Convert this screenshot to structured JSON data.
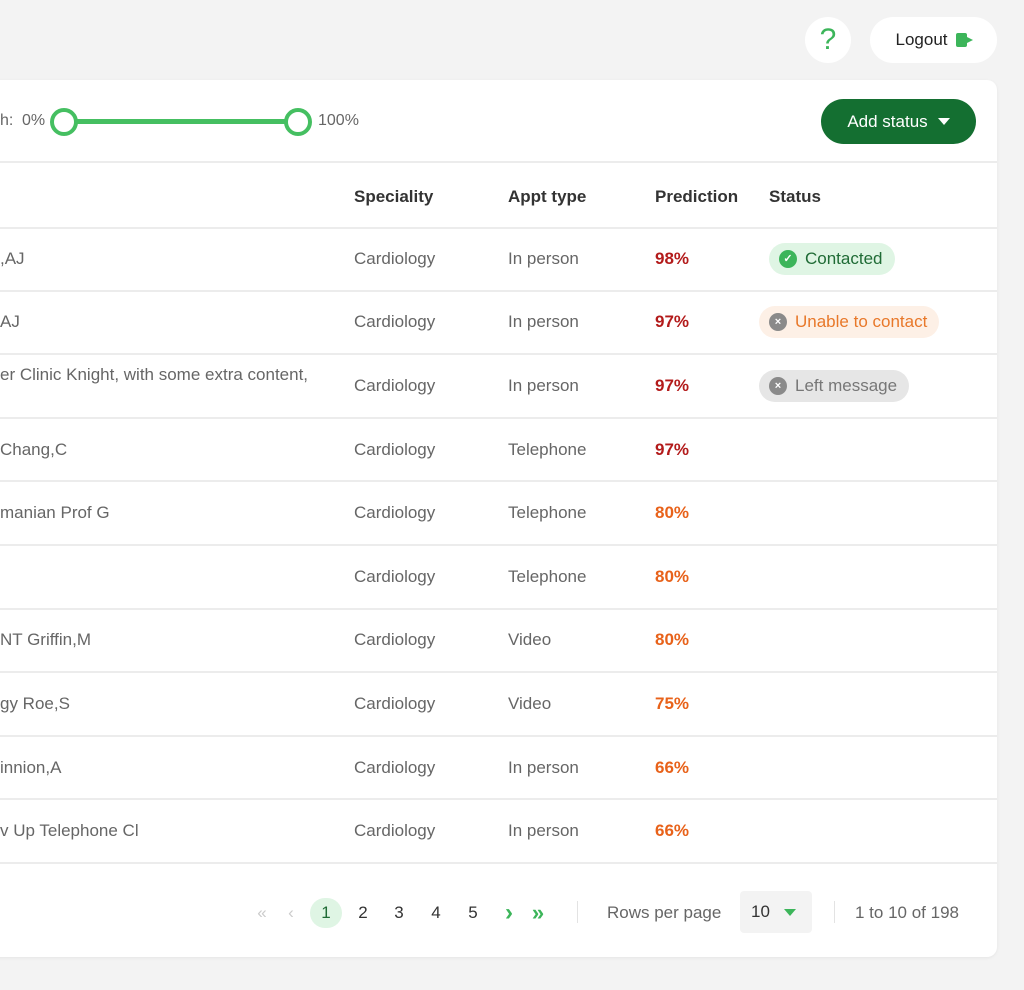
{
  "header": {
    "help_label": "?",
    "logout_label": "Logout"
  },
  "filter": {
    "label_fragment": "h:",
    "min_label": "0%",
    "max_label": "100%",
    "range_min_percent": 0,
    "range_max_percent": 100
  },
  "add_status_label": "Add status",
  "table": {
    "columns": [
      "Speciality",
      "Appt type",
      "Prediction",
      "Status"
    ],
    "rows": [
      {
        "name": ",AJ",
        "speciality": "Cardiology",
        "appt": "In person",
        "prediction": "98%",
        "pred_color": "#b31b1b",
        "status": "Contacted",
        "status_kind": "contacted"
      },
      {
        "name": " AJ",
        "speciality": "Cardiology",
        "appt": "In person",
        "prediction": "97%",
        "pred_color": "#b31b1b",
        "status": "Unable to contact",
        "status_kind": "unable"
      },
      {
        "name": "er Clinic Knight, with some extra content,",
        "speciality": "Cardiology",
        "appt": "In person",
        "prediction": "97%",
        "pred_color": "#b31b1b",
        "status": "Left message",
        "status_kind": "left"
      },
      {
        "name": "Chang,C",
        "speciality": "Cardiology",
        "appt": "Telephone",
        "prediction": "97%",
        "pred_color": "#b31b1b",
        "status": ""
      },
      {
        "name": "manian Prof G",
        "speciality": "Cardiology",
        "appt": "Telephone",
        "prediction": "80%",
        "pred_color": "#e8621a",
        "status": ""
      },
      {
        "name": "",
        "speciality": "Cardiology",
        "appt": "Telephone",
        "prediction": "80%",
        "pred_color": "#e8621a",
        "status": ""
      },
      {
        "name": "NT Griffin,M",
        "speciality": "Cardiology",
        "appt": "Video",
        "prediction": "80%",
        "pred_color": "#e8621a",
        "status": ""
      },
      {
        "name": "gy Roe,S",
        "speciality": "Cardiology",
        "appt": "Video",
        "prediction": "75%",
        "pred_color": "#e8621a",
        "status": ""
      },
      {
        "name": "innion,A",
        "speciality": "Cardiology",
        "appt": "In person",
        "prediction": "66%",
        "pred_color": "#e8621a",
        "status": ""
      },
      {
        "name": "v Up Telephone Cl",
        "speciality": "Cardiology",
        "appt": "In person",
        "prediction": "66%",
        "pred_color": "#e8621a",
        "status": ""
      }
    ]
  },
  "status_styles": {
    "contacted": {
      "bg": "#dff5e4",
      "fg": "#1f6b35",
      "icon_bg": "#3cb55a",
      "icon": "✓"
    },
    "unable": {
      "bg": "#fdf0e6",
      "fg": "#e8782a",
      "icon_bg": "#8a8a8a",
      "icon": "×"
    },
    "left": {
      "bg": "#e6e6e6",
      "fg": "#777",
      "icon_bg": "#8a8a8a",
      "icon": "×"
    }
  },
  "pagination": {
    "first": "«",
    "prev": "‹",
    "pages": [
      "1",
      "2",
      "3",
      "4",
      "5"
    ],
    "current": "1",
    "next": "›",
    "last": "»",
    "rows_per_page_label": "Rows per page",
    "rows_per_page_value": "10",
    "range_text": "1 to 10 of 198"
  }
}
